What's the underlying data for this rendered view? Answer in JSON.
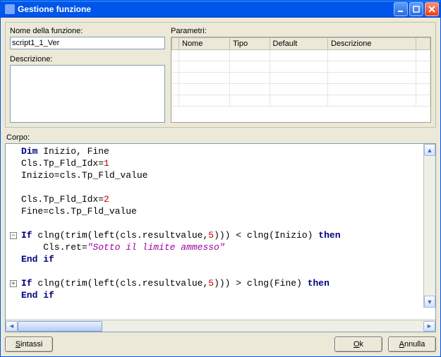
{
  "window": {
    "title": "Gestione funzione"
  },
  "labels": {
    "funcName": "Nome della funzione:",
    "description": "Descrizione:",
    "params": "Parametri:",
    "body": "Corpo:"
  },
  "inputs": {
    "funcName": "script1_1_Ver",
    "description": ""
  },
  "paramGrid": {
    "headers": [
      "Nome",
      "Tipo",
      "Default",
      "Descrizione"
    ],
    "rows": [
      [
        "",
        "",
        "",
        ""
      ],
      [
        "",
        "",
        "",
        ""
      ],
      [
        "",
        "",
        "",
        ""
      ],
      [
        "",
        "",
        "",
        ""
      ],
      [
        "",
        "",
        "",
        ""
      ]
    ]
  },
  "code": {
    "lines": [
      {
        "fold": null,
        "seg": [
          {
            "t": "kw",
            "v": "Dim"
          },
          {
            "t": "",
            "v": " Inizio, Fine"
          }
        ]
      },
      {
        "fold": null,
        "seg": [
          {
            "t": "",
            "v": "Cls.Tp_Fld_Idx="
          },
          {
            "t": "num",
            "v": "1"
          }
        ]
      },
      {
        "fold": null,
        "seg": [
          {
            "t": "",
            "v": "Inizio=cls.Tp_Fld_value"
          }
        ]
      },
      {
        "fold": null,
        "seg": []
      },
      {
        "fold": null,
        "seg": [
          {
            "t": "",
            "v": "Cls.Tp_Fld_Idx="
          },
          {
            "t": "num",
            "v": "2"
          }
        ]
      },
      {
        "fold": null,
        "seg": [
          {
            "t": "",
            "v": "Fine=cls.Tp_Fld_value"
          }
        ]
      },
      {
        "fold": null,
        "seg": []
      },
      {
        "fold": "minus",
        "seg": [
          {
            "t": "kw",
            "v": "If"
          },
          {
            "t": "",
            "v": " clng(trim(left(cls.resultvalue,"
          },
          {
            "t": "num",
            "v": "5"
          },
          {
            "t": "",
            "v": "))) < clng(Inizio) "
          },
          {
            "t": "kw",
            "v": "then"
          }
        ]
      },
      {
        "fold": null,
        "seg": [
          {
            "t": "",
            "v": "    Cls.ret="
          },
          {
            "t": "str",
            "v": "\"Sotto il limite ammesso\""
          }
        ]
      },
      {
        "fold": null,
        "seg": [
          {
            "t": "kw",
            "v": "End if"
          }
        ]
      },
      {
        "fold": null,
        "seg": []
      },
      {
        "fold": "plus",
        "seg": [
          {
            "t": "kw",
            "v": "If"
          },
          {
            "t": "",
            "v": " clng(trim(left(cls.resultvalue,"
          },
          {
            "t": "num",
            "v": "5"
          },
          {
            "t": "",
            "v": "))) > clng(Fine) "
          },
          {
            "t": "kw",
            "v": "then"
          }
        ]
      },
      {
        "fold": null,
        "seg": [
          {
            "t": "kw",
            "v": "End if"
          }
        ]
      }
    ]
  },
  "buttons": {
    "syntax": "Sintassi",
    "ok": "Ok",
    "cancel": "Annulla"
  }
}
